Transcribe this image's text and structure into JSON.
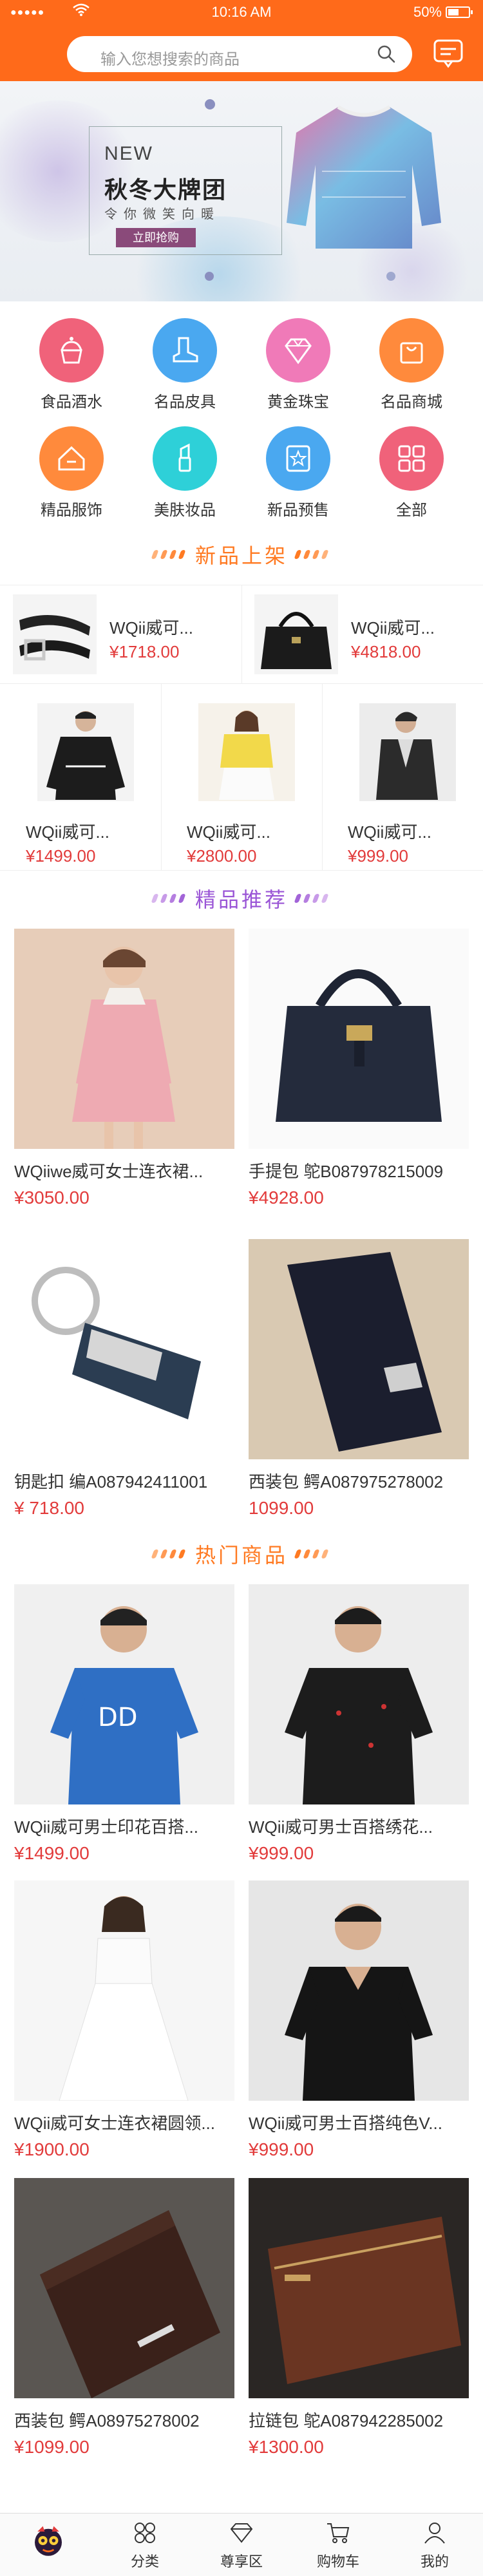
{
  "status": {
    "time": "10:16 AM",
    "battery": "50%"
  },
  "search": {
    "placeholder": "输入您想搜索的商品"
  },
  "banner": {
    "tag": "NEW",
    "title": "秋冬大牌团",
    "subtitle": "令你微笑向暖",
    "button": "立即抢购"
  },
  "categories": [
    {
      "label": "食品酒水",
      "icon": "cake-icon",
      "color": "#f0627a"
    },
    {
      "label": "名品皮具",
      "icon": "boot-icon",
      "color": "#4aa8f0"
    },
    {
      "label": "黄金珠宝",
      "icon": "diamond-icon",
      "color": "#f07ab8"
    },
    {
      "label": "名品商城",
      "icon": "shopping-bag-icon",
      "color": "#ff8a3c"
    },
    {
      "label": "精品服饰",
      "icon": "clothing-icon",
      "color": "#ff8a3c"
    },
    {
      "label": "美肤妆品",
      "icon": "lipstick-icon",
      "color": "#2ed0d8"
    },
    {
      "label": "新品预售",
      "icon": "star-badge-icon",
      "color": "#4aa8f0"
    },
    {
      "label": "全部",
      "icon": "grid-icon",
      "color": "#f0627a"
    }
  ],
  "sections": {
    "new": "新品上架",
    "recommended": "精品推荐",
    "hot": "热门商品"
  },
  "new_row1": [
    {
      "name": "WQii威可...",
      "price": "¥1718.00"
    },
    {
      "name": "WQii威可...",
      "price": "¥4818.00"
    }
  ],
  "new_row2": [
    {
      "name": "WQii威可...",
      "price": "¥1499.00"
    },
    {
      "name": "WQii威可...",
      "price": "¥2800.00"
    },
    {
      "name": "WQii威可...",
      "price": "¥999.00"
    }
  ],
  "recommended": [
    {
      "name": "WQiiwe威可女士连衣裙...",
      "price": "¥3050.00"
    },
    {
      "name": "手提包 鸵B087978215009",
      "price": "¥4928.00"
    },
    {
      "name": "钥匙扣 编A087942411001",
      "price": "¥ 718.00"
    },
    {
      "name": "西装包 鳄A087975278002",
      "price": "1099.00"
    }
  ],
  "hot": [
    {
      "name": "WQii威可男士印花百搭...",
      "price": "¥1499.00"
    },
    {
      "name": "WQii威可男士百搭绣花...",
      "price": "¥999.00"
    },
    {
      "name": "WQii威可女士连衣裙圆领...",
      "price": "¥1900.00"
    },
    {
      "name": "WQii威可男士百搭纯色V...",
      "price": "¥999.00"
    },
    {
      "name": "西装包 鳄A08975278002",
      "price": "¥1099.00"
    },
    {
      "name": "拉链包 鸵A087942285002",
      "price": "¥1300.00"
    }
  ],
  "tabs": [
    {
      "label": "",
      "icon": "mascot-icon"
    },
    {
      "label": "分类",
      "icon": "category-icon"
    },
    {
      "label": "尊享区",
      "icon": "diamond-icon"
    },
    {
      "label": "购物车",
      "icon": "cart-icon"
    },
    {
      "label": "我的",
      "icon": "user-icon"
    }
  ],
  "colors": {
    "brand": "#ff6a1a",
    "price": "#e23b3b"
  }
}
